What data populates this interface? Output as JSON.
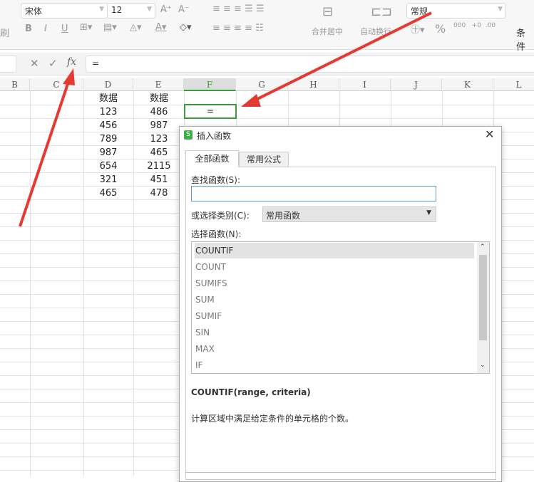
{
  "toolbar": {
    "font": "宋体",
    "size": "12",
    "number_format": "常规",
    "merge": "合并居中",
    "wrap": "自动换行",
    "cond": "条件",
    "left_cut": "刷",
    "bold": "B",
    "italic": "I",
    "underline": "U",
    "percent": "%",
    "grow": "A⁺",
    "shrink": "A⁻"
  },
  "formula_bar": {
    "value": "=",
    "fx": "fx",
    "cancel": "✕",
    "confirm": "✓"
  },
  "columns": [
    "B",
    "C",
    "D",
    "E",
    "F",
    "G",
    "H",
    "I",
    "J",
    "K",
    "L"
  ],
  "sheet": {
    "D": [
      "数据",
      "123",
      "456",
      "789",
      "987",
      "654",
      "321",
      "465"
    ],
    "E": [
      "数据",
      "486",
      "987",
      "123",
      "465",
      "2115",
      "451",
      "478"
    ],
    "F2": "="
  },
  "dialog": {
    "title": "插入函数",
    "tabs": [
      "全部函数",
      "常用公式"
    ],
    "search_label": "查找函数(S):",
    "search_value": "",
    "category_label": "或选择类别(C):",
    "category_value": "常用函数",
    "select_label": "选择函数(N):",
    "functions": [
      "COUNTIF",
      "COUNT",
      "SUMIFS",
      "SUM",
      "SUMIF",
      "SIN",
      "MAX",
      "IF"
    ],
    "selected": "COUNTIF",
    "signature": "COUNTIF(range, criteria)",
    "description": "计算区域中满足给定条件的单元格的个数。"
  },
  "colors": {
    "accent": "#3b9a3b",
    "arrow": "#e53a33"
  }
}
